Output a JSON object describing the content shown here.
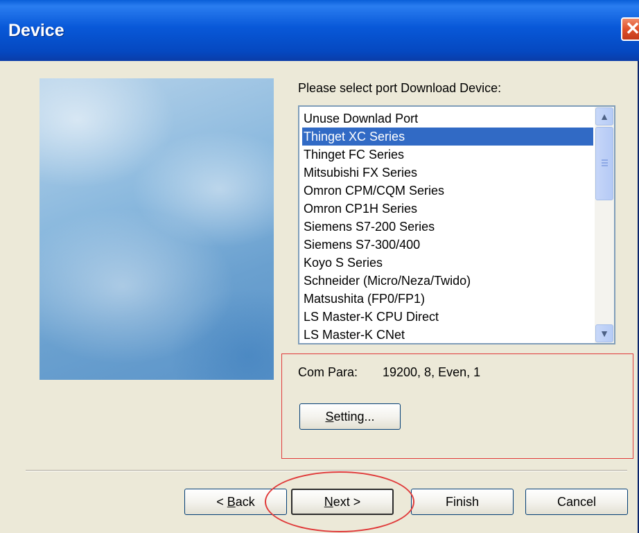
{
  "window": {
    "title": "Device",
    "close_glyph": "✕"
  },
  "prompt": "Please select port Download Device:",
  "device_list": {
    "items": [
      "Unuse Downlad Port",
      "Thinget XC Series",
      "Thinget FC Series",
      "Mitsubishi FX Series",
      "Omron CPM/CQM Series",
      "Omron CP1H Series",
      "Siemens S7-200 Series",
      "Siemens S7-300/400",
      "Koyo S Series",
      "Schneider (Micro/Neza/Twido)",
      "Matsushita (FP0/FP1)",
      "LS Master-K CPU Direct",
      "LS Master-K CNet"
    ],
    "selected": "Thinget XC Series",
    "scroll_up_glyph": "▲",
    "scroll_down_glyph": "▼"
  },
  "com": {
    "label": "Com Para:",
    "value": "19200, 8, Even, 1"
  },
  "buttons": {
    "setting": {
      "mnemonic": "S",
      "rest": "etting..."
    },
    "back": {
      "prefix": "< ",
      "mnemonic": "B",
      "rest": "ack"
    },
    "next": {
      "mnemonic": "N",
      "rest": "ext >"
    },
    "finish": "Finish",
    "cancel": "Cancel"
  },
  "colors": {
    "title_bar": "#0a5fd8",
    "selection": "#316ac5",
    "annotation": "#e03a3a"
  },
  "icons": {
    "close": "close-icon",
    "scroll_up": "chevron-up-icon",
    "scroll_down": "chevron-down-icon"
  }
}
